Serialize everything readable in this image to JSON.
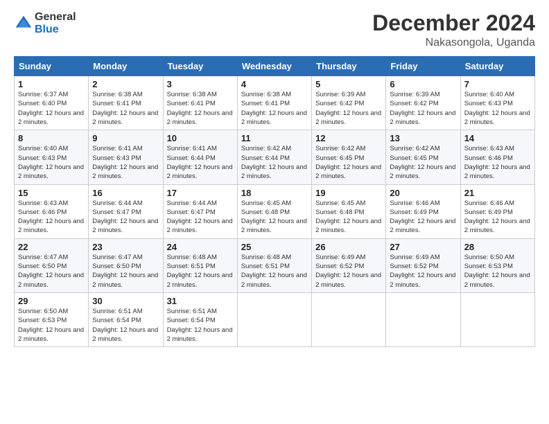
{
  "logo": {
    "general": "General",
    "blue": "Blue"
  },
  "title": "December 2024",
  "subtitle": "Nakasongola, Uganda",
  "days_of_week": [
    "Sunday",
    "Monday",
    "Tuesday",
    "Wednesday",
    "Thursday",
    "Friday",
    "Saturday"
  ],
  "weeks": [
    [
      {
        "day": 1,
        "sunrise": "6:37 AM",
        "sunset": "6:40 PM",
        "daylight": "12 hours and 2 minutes."
      },
      {
        "day": 2,
        "sunrise": "6:38 AM",
        "sunset": "6:41 PM",
        "daylight": "12 hours and 2 minutes."
      },
      {
        "day": 3,
        "sunrise": "6:38 AM",
        "sunset": "6:41 PM",
        "daylight": "12 hours and 2 minutes."
      },
      {
        "day": 4,
        "sunrise": "6:38 AM",
        "sunset": "6:41 PM",
        "daylight": "12 hours and 2 minutes."
      },
      {
        "day": 5,
        "sunrise": "6:39 AM",
        "sunset": "6:42 PM",
        "daylight": "12 hours and 2 minutes."
      },
      {
        "day": 6,
        "sunrise": "6:39 AM",
        "sunset": "6:42 PM",
        "daylight": "12 hours and 2 minutes."
      },
      {
        "day": 7,
        "sunrise": "6:40 AM",
        "sunset": "6:43 PM",
        "daylight": "12 hours and 2 minutes."
      }
    ],
    [
      {
        "day": 8,
        "sunrise": "6:40 AM",
        "sunset": "6:43 PM",
        "daylight": "12 hours and 2 minutes."
      },
      {
        "day": 9,
        "sunrise": "6:41 AM",
        "sunset": "6:43 PM",
        "daylight": "12 hours and 2 minutes."
      },
      {
        "day": 10,
        "sunrise": "6:41 AM",
        "sunset": "6:44 PM",
        "daylight": "12 hours and 2 minutes."
      },
      {
        "day": 11,
        "sunrise": "6:42 AM",
        "sunset": "6:44 PM",
        "daylight": "12 hours and 2 minutes."
      },
      {
        "day": 12,
        "sunrise": "6:42 AM",
        "sunset": "6:45 PM",
        "daylight": "12 hours and 2 minutes."
      },
      {
        "day": 13,
        "sunrise": "6:42 AM",
        "sunset": "6:45 PM",
        "daylight": "12 hours and 2 minutes."
      },
      {
        "day": 14,
        "sunrise": "6:43 AM",
        "sunset": "6:46 PM",
        "daylight": "12 hours and 2 minutes."
      }
    ],
    [
      {
        "day": 15,
        "sunrise": "6:43 AM",
        "sunset": "6:46 PM",
        "daylight": "12 hours and 2 minutes."
      },
      {
        "day": 16,
        "sunrise": "6:44 AM",
        "sunset": "6:47 PM",
        "daylight": "12 hours and 2 minutes."
      },
      {
        "day": 17,
        "sunrise": "6:44 AM",
        "sunset": "6:47 PM",
        "daylight": "12 hours and 2 minutes."
      },
      {
        "day": 18,
        "sunrise": "6:45 AM",
        "sunset": "6:48 PM",
        "daylight": "12 hours and 2 minutes."
      },
      {
        "day": 19,
        "sunrise": "6:45 AM",
        "sunset": "6:48 PM",
        "daylight": "12 hours and 2 minutes."
      },
      {
        "day": 20,
        "sunrise": "6:46 AM",
        "sunset": "6:49 PM",
        "daylight": "12 hours and 2 minutes."
      },
      {
        "day": 21,
        "sunrise": "6:46 AM",
        "sunset": "6:49 PM",
        "daylight": "12 hours and 2 minutes."
      }
    ],
    [
      {
        "day": 22,
        "sunrise": "6:47 AM",
        "sunset": "6:50 PM",
        "daylight": "12 hours and 2 minutes."
      },
      {
        "day": 23,
        "sunrise": "6:47 AM",
        "sunset": "6:50 PM",
        "daylight": "12 hours and 2 minutes."
      },
      {
        "day": 24,
        "sunrise": "6:48 AM",
        "sunset": "6:51 PM",
        "daylight": "12 hours and 2 minutes."
      },
      {
        "day": 25,
        "sunrise": "6:48 AM",
        "sunset": "6:51 PM",
        "daylight": "12 hours and 2 minutes."
      },
      {
        "day": 26,
        "sunrise": "6:49 AM",
        "sunset": "6:52 PM",
        "daylight": "12 hours and 2 minutes."
      },
      {
        "day": 27,
        "sunrise": "6:49 AM",
        "sunset": "6:52 PM",
        "daylight": "12 hours and 2 minutes."
      },
      {
        "day": 28,
        "sunrise": "6:50 AM",
        "sunset": "6:53 PM",
        "daylight": "12 hours and 2 minutes."
      }
    ],
    [
      {
        "day": 29,
        "sunrise": "6:50 AM",
        "sunset": "6:53 PM",
        "daylight": "12 hours and 2 minutes."
      },
      {
        "day": 30,
        "sunrise": "6:51 AM",
        "sunset": "6:54 PM",
        "daylight": "12 hours and 2 minutes."
      },
      {
        "day": 31,
        "sunrise": "6:51 AM",
        "sunset": "6:54 PM",
        "daylight": "12 hours and 2 minutes."
      },
      null,
      null,
      null,
      null
    ]
  ]
}
